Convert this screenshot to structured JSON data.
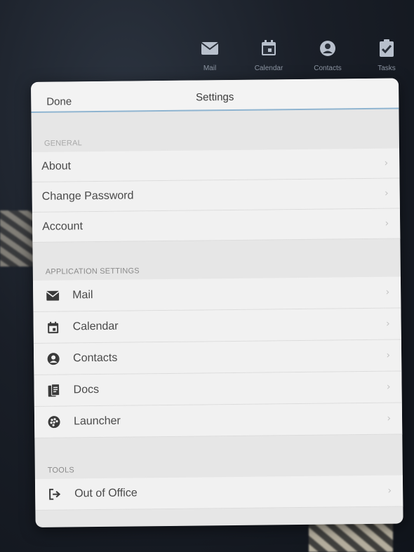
{
  "app_tabs": [
    {
      "label": "Mail",
      "icon": "mail-icon"
    },
    {
      "label": "Calendar",
      "icon": "calendar-icon"
    },
    {
      "label": "Contacts",
      "icon": "contacts-icon"
    },
    {
      "label": "Tasks",
      "icon": "tasks-icon"
    }
  ],
  "settings": {
    "done_label": "Done",
    "title": "Settings",
    "sections": {
      "general": {
        "header": "GENERAL",
        "items": [
          {
            "label": "About"
          },
          {
            "label": "Change Password"
          },
          {
            "label": "Account"
          }
        ]
      },
      "application": {
        "header": "APPLICATION SETTINGS",
        "items": [
          {
            "label": "Mail",
            "icon": "mail-icon"
          },
          {
            "label": "Calendar",
            "icon": "calendar-icon"
          },
          {
            "label": "Contacts",
            "icon": "contacts-icon"
          },
          {
            "label": "Docs",
            "icon": "docs-icon"
          },
          {
            "label": "Launcher",
            "icon": "launcher-icon"
          }
        ]
      },
      "tools": {
        "header": "TOOLS",
        "items": [
          {
            "label": "Out of Office",
            "icon": "sign-out-icon"
          }
        ]
      }
    }
  },
  "chevron": "›",
  "colors": {
    "modal_bg": "#e6e6e6",
    "row_bg": "#f1f1f1",
    "accent_line": "#8fb4d0"
  }
}
